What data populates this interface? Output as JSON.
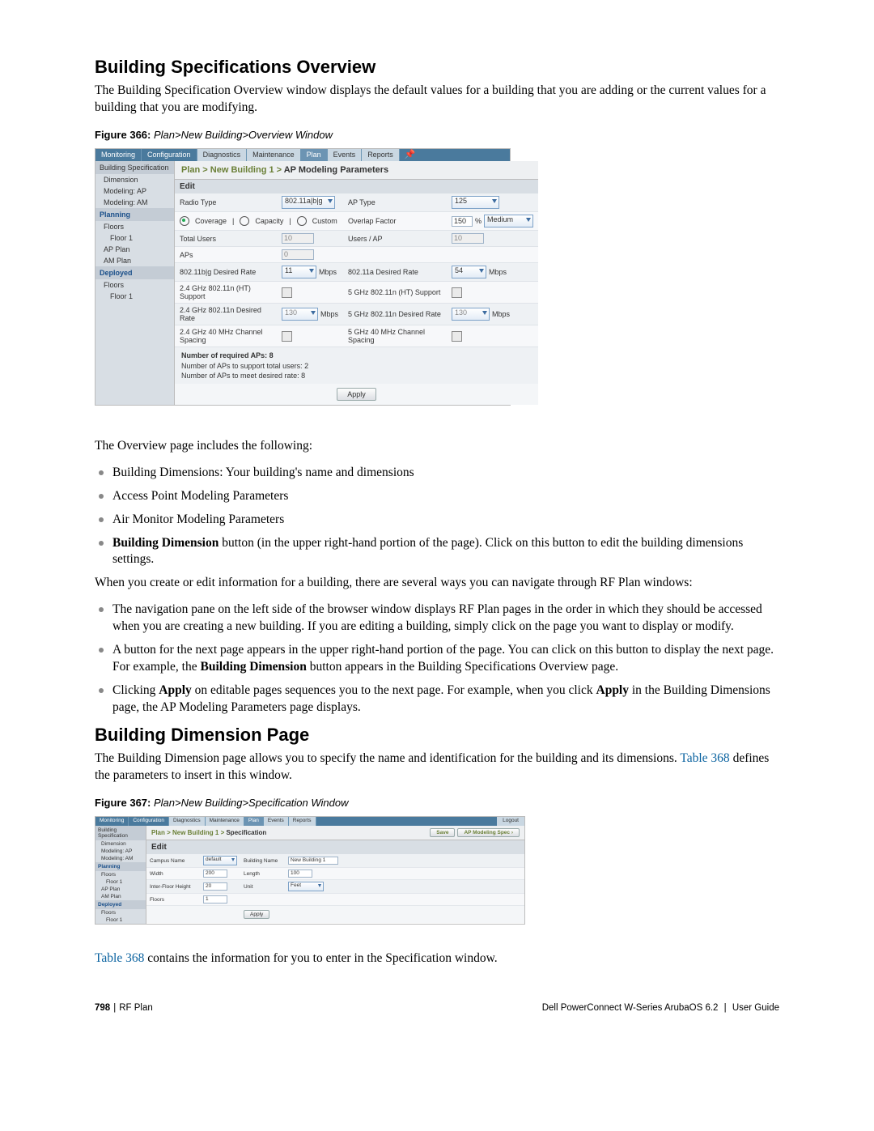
{
  "headings": {
    "h1": "Building Specifications Overview",
    "h2": "Building Dimension Page"
  },
  "paras": {
    "intro1": "The Building Specification Overview window displays the default values for a building that you are adding or the current values for a building that you are modifying.",
    "overview_leadin": "The Overview page includes the following:",
    "nav_intro": "When you create or edit information for a building, there are several ways you can navigate through RF Plan windows:",
    "dimpage_intro": "The Building Dimension page allows you to specify the name and identification for the building and its dimensions. ",
    "dimpage_tableref": " defines the parameters to insert in this window.",
    "tableref2a": " contains the information for you to enter in the Specification window."
  },
  "links": {
    "table368": "Table 368"
  },
  "figcaps": {
    "f366_label": "Figure 366:",
    "f366_title": "Plan>New Building>Overview Window",
    "f367_label": "Figure 367:",
    "f367_title": "Plan>New Building>Specification Window"
  },
  "bullets1": {
    "b0": "Building Dimensions: Your building's name and dimensions",
    "b1": "Access Point Modeling Parameters",
    "b2": "Air Monitor Modeling Parameters",
    "b3a": "Building Dimension",
    "b3b": " button (in the upper right-hand portion of the page). Click on this button to edit the building dimensions settings."
  },
  "bullets2": {
    "b0": "The navigation pane on the left side of the browser window displays RF Plan pages in the order in which they should be accessed when you are creating a new building. If you are editing a building, simply click on the page you want to display or modify.",
    "b1a": "A button for the next page appears in the upper right-hand portion of the page. You can click on this button to display the next page. For example, the ",
    "b1b": "Building Dimension",
    "b1c": " button appears in the Building Specifications Overview page.",
    "b2a": "Clicking ",
    "b2b": "Apply",
    "b2c": " on editable pages sequences you to the next page. For example, when you click ",
    "b2d": "Apply",
    "b2e": " in the Building Dimensions page, the AP Modeling Parameters page displays."
  },
  "shot1": {
    "tabs": {
      "monitoring": "Monitoring",
      "configuration": "Configuration",
      "diagnostics": "Diagnostics",
      "maintenance": "Maintenance",
      "plan": "Plan",
      "events": "Events",
      "reports": "Reports",
      "pin": "📌"
    },
    "side": {
      "hdr_buildspec": "Building Specification",
      "dimension": "Dimension",
      "modeling_ap": "Modeling: AP",
      "modeling_am": "Modeling: AM",
      "hdr_planning": "Planning",
      "floors": "Floors",
      "floor1": "Floor 1",
      "ap_plan": "AP Plan",
      "am_plan": "AM Plan",
      "hdr_deployed": "Deployed",
      "d_floors": "Floors",
      "d_floor1": "Floor 1"
    },
    "bc_prefix": "Plan > New Building 1 > ",
    "bc_strong": "AP Modeling Parameters",
    "edit_label": "Edit",
    "rows": {
      "radio_type": "Radio Type",
      "radio_type_val": "802.11a|b|g",
      "ap_type": "AP Type",
      "ap_type_val": "125",
      "radio_cov": "Coverage",
      "radio_cap": "Capacity",
      "radio_cust": "Custom",
      "overlap": "Overlap Factor",
      "overlap_val": "150",
      "overlap_pct": "%",
      "overlap_level": "Medium",
      "total_users": "Total Users",
      "total_users_val": "10",
      "users_ap": "Users / AP",
      "users_ap_val": "10",
      "aps": "APs",
      "aps_val": "0",
      "bg_rate": "802.11b|g Desired Rate",
      "bg_rate_val": "11",
      "mbps": "Mbps",
      "a_rate": "802.11a Desired Rate",
      "a_rate_val": "54",
      "g24_ht": "2.4 GHz 802.11n (HT) Support",
      "g5_ht": "5 GHz 802.11n (HT) Support",
      "g24_n_rate": "2.4 GHz 802.11n Desired Rate",
      "g24_n_rate_val": "130",
      "g5_n_rate": "5 GHz 802.11n Desired Rate",
      "g5_n_rate_val": "130",
      "g24_40_sp": "2.4 GHz 40 MHz Channel Spacing",
      "g5_40_sp": "5 GHz 40 MHz Channel Spacing"
    },
    "req": {
      "hd": "Number of required APs: 8",
      "l1": "Number of APs to support total users: 2",
      "l2": "Number of APs to meet desired rate: 8"
    },
    "apply": "Apply"
  },
  "shot2": {
    "tabs": {
      "monitoring": "Monitoring",
      "configuration": "Configuration",
      "diagnostics": "Diagnostics",
      "maintenance": "Maintenance",
      "plan": "Plan",
      "events": "Events",
      "reports": "Reports",
      "logout": "Logout"
    },
    "side": {
      "hdr_buildspec": "Building Specification",
      "dimension": "Dimension",
      "modeling_ap": "Modeling: AP",
      "modeling_am": "Modeling: AM",
      "hdr_planning": "Planning",
      "floors": "Floors",
      "floor1": "Floor 1",
      "ap_plan": "AP Plan",
      "am_plan": "AM Plan",
      "hdr_deployed": "Deployed",
      "d_floors": "Floors",
      "d_floor1": "Floor 1"
    },
    "bc_prefix": "Plan > New Building 1 > ",
    "bc_strong": "Specification",
    "topbtn_save": "Save",
    "topbtn_apmodel": "AP Modeling Spec ›",
    "edit_label": "Edit",
    "rows": {
      "campus": "Campus Name",
      "campus_val": "default",
      "bname": "Building Name",
      "bname_val": "New Building 1",
      "width": "Width",
      "width_val": "200",
      "length": "Length",
      "length_val": "100",
      "ifh": "Inter-Floor Height",
      "ifh_val": "20",
      "unit": "Unit",
      "unit_val": "Feet",
      "floors": "Floors",
      "floors_val": "1"
    },
    "apply": "Apply"
  },
  "footer": {
    "page": "798",
    "section": "RF Plan",
    "product": "Dell PowerConnect W-Series ArubaOS 6.2",
    "doc": "User Guide"
  }
}
